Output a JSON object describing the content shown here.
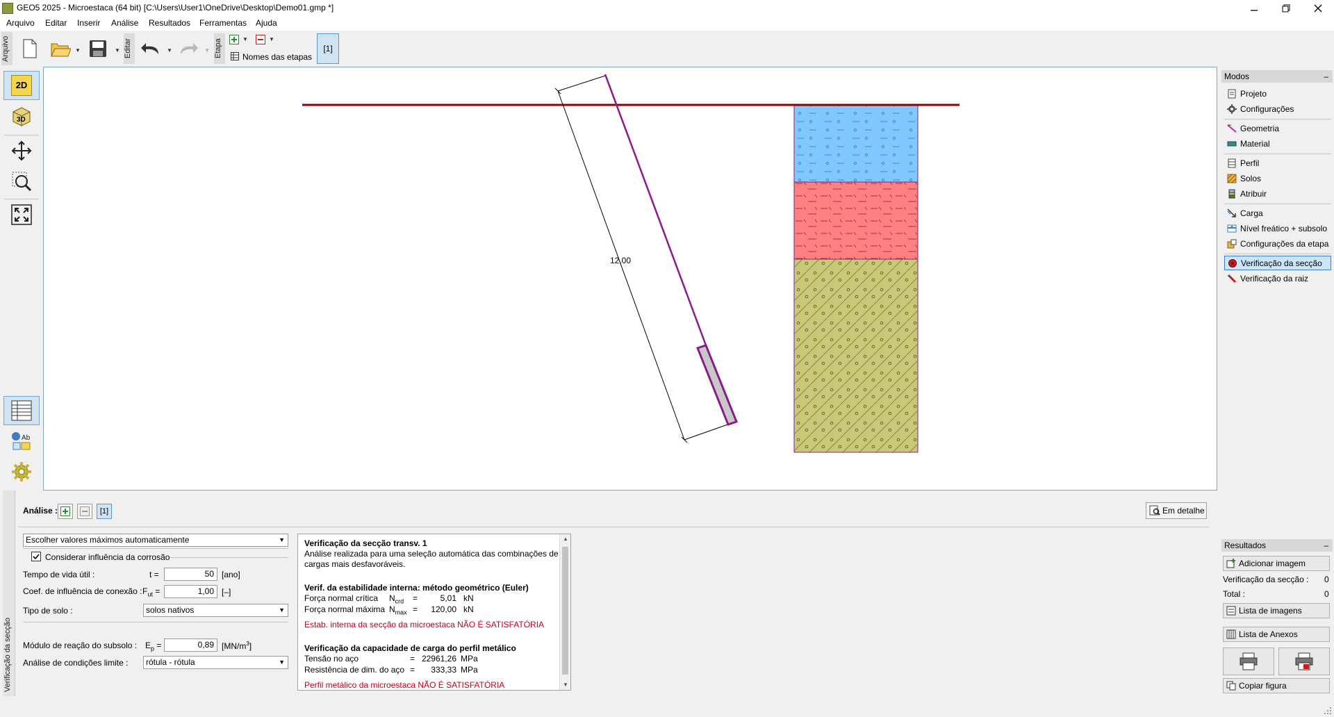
{
  "window": {
    "title": "GEO5 2025 - Microestaca (64 bit) [C:\\Users\\User1\\OneDrive\\Desktop\\Demo01.gmp *]",
    "minimize": "🗕",
    "restore": "🗗",
    "close": "✕"
  },
  "menu": [
    "Arquivo",
    "Editar",
    "Inserir",
    "Análise",
    "Resultados",
    "Ferramentas",
    "Ajuda"
  ],
  "toolbar": {
    "file_label": "Arquivo",
    "edit_label": "Editar",
    "stage_label": "Etapa",
    "stage_names": "Nomes das etapas",
    "stage_current": "[1]"
  },
  "left_tools": {
    "btn_2d": "2D",
    "btn_3d": "3D"
  },
  "canvas": {
    "dimension_label": "12,00"
  },
  "modes": {
    "header": "Modos",
    "collapse": "–",
    "items": [
      {
        "label": "Projeto",
        "icon": "document-icon"
      },
      {
        "label": "Configurações",
        "icon": "gear-icon"
      },
      {
        "label": "Geometria",
        "icon": "geometry-icon"
      },
      {
        "label": "Material",
        "icon": "material-icon"
      },
      {
        "label": "Perfil",
        "icon": "profile-icon"
      },
      {
        "label": "Solos",
        "icon": "soils-icon"
      },
      {
        "label": "Atribuir",
        "icon": "assign-icon"
      },
      {
        "label": "Carga",
        "icon": "load-icon"
      },
      {
        "label": "Nível freático + subsolo",
        "icon": "water-table-icon"
      },
      {
        "label": "Configurações da etapa",
        "icon": "stage-settings-icon"
      },
      {
        "label": "Verificação da secção",
        "icon": "section-check-icon"
      },
      {
        "label": "Verificação da raiz",
        "icon": "root-check-icon"
      }
    ],
    "active_index": 10
  },
  "analysis": {
    "side_label": "Verificação da secção",
    "label": "Análise :",
    "add": "+",
    "remove": "–",
    "current": "[1]",
    "detail_button": "Em detalhe",
    "auto_select": "Escolher valores máximos automaticamente",
    "corrosion_checkbox": "Considerar influência da corrosão",
    "corrosion_checked": true,
    "lifetime_label": "Tempo de vida útil :",
    "lifetime_symbol": "t =",
    "lifetime_value": "50",
    "lifetime_unit": "[ano]",
    "coef_label": "Coef. de influência de conexão :",
    "coef_symbol_main": "F",
    "coef_symbol_sub": "ut",
    "coef_symbol_eq": " =",
    "coef_value": "1,00",
    "coef_unit": "[–]",
    "soil_type_label": "Tipo de solo :",
    "soil_type_value": "solos nativos",
    "modulus_label": "Módulo de reação do subsolo :",
    "modulus_symbol_main": "E",
    "modulus_symbol_sub": "p",
    "modulus_symbol_eq": " =",
    "modulus_value": "0,89",
    "modulus_unit_main": "[MN/m",
    "modulus_unit_sup": "3",
    "modulus_unit_end": "]",
    "limit_label": "Análise de condições limite :",
    "limit_value": "rótula - rótula"
  },
  "results_text": {
    "title1": "Verificação da secção transv. 1",
    "desc1": "Análise realizada para uma seleção automática das combinações de",
    "desc2": "cargas mais desfavoráveis.",
    "title2": "Verif. da estabilidade interna: método geométrico (Euler)",
    "ncrd_label": "Força normal crítica",
    "ncrd_sym_main": "N",
    "ncrd_sym_sub": "crd",
    "ncrd_eq": "=",
    "ncrd_value": "5,01",
    "ncrd_unit": "kN",
    "nmax_label": "Força normal máxima",
    "nmax_sym_main": "N",
    "nmax_sym_sub": "max",
    "nmax_eq": "=",
    "nmax_value": "120,00",
    "nmax_unit": "kN",
    "fail1": "Estab. interna da secção da microestaca NÃO É SATISFATÓRIA",
    "title3": "Verificação da capacidade de carga do perfil metálico",
    "stress_label": "Tensão no aço",
    "stress_eq": "=",
    "stress_value": "22961,26",
    "stress_unit": "MPa",
    "resist_label": "Resistência de dim. do aço",
    "resist_eq": "=",
    "resist_value": "333,33",
    "resist_unit": "MPa",
    "fail2": "Perfil metálico da microestaca NÃO É SATISFATÓRIA"
  },
  "results_panel": {
    "header": "Resultados",
    "collapse": "–",
    "add_image": "Adicionar imagem",
    "section_check_label": "Verificação da secção :",
    "section_check_count": "0",
    "total_label": "Total :",
    "total_count": "0",
    "image_list": "Lista de imagens",
    "annex_list": "Lista de Anexos",
    "copy_figure": "Copiar figura"
  },
  "colors": {
    "accent": "#3d7cc9",
    "layer1": "#80c8ff",
    "layer2": "#ff8080",
    "layer3": "#c8c878",
    "terrain": "#8b0000",
    "pile": "#8b1a8b",
    "fail": "#c0001a"
  }
}
